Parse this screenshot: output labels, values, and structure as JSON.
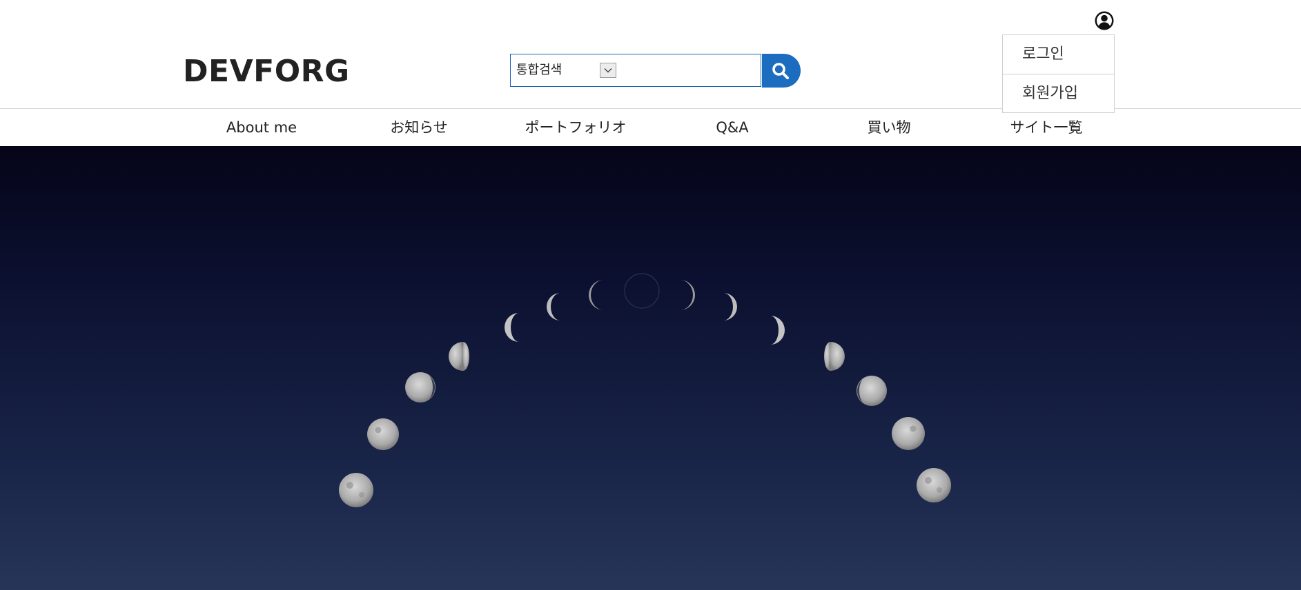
{
  "site": {
    "logo": "DEVFORG"
  },
  "search": {
    "scope_label": "통합검색",
    "input_value": "",
    "placeholder": ""
  },
  "user_menu": {
    "items": [
      {
        "label": "로그인"
      },
      {
        "label": "회원가입"
      }
    ]
  },
  "nav": {
    "items": [
      {
        "label": "About me"
      },
      {
        "label": "お知らせ"
      },
      {
        "label": "ポートフォリオ"
      },
      {
        "label": "Q&A"
      },
      {
        "label": "買い物"
      },
      {
        "label": "サイト一覧"
      }
    ]
  },
  "hero": {
    "image": "moon-phases-arc-night-sky"
  },
  "colors": {
    "accent": "#1c6dbf",
    "search_border": "#1f63b5",
    "text": "#222222",
    "hero_top": "#050519",
    "hero_bottom": "#273558"
  },
  "icons": {
    "search": "search-icon",
    "dropdown": "chevron-down-icon",
    "user": "user-circle-icon"
  }
}
